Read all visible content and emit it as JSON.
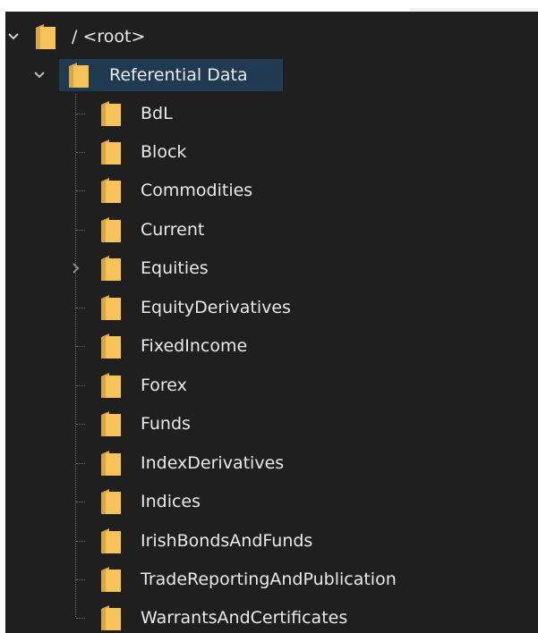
{
  "tree": {
    "root": {
      "label": "/ <root>",
      "expanded": true
    },
    "referential": {
      "label": "Referential Data",
      "expanded": true,
      "selected": true
    },
    "children": [
      {
        "label": "BdL",
        "has_children": false
      },
      {
        "label": "Block",
        "has_children": false
      },
      {
        "label": "Commodities",
        "has_children": false
      },
      {
        "label": "Current",
        "has_children": false
      },
      {
        "label": "Equities",
        "has_children": true
      },
      {
        "label": "EquityDerivatives",
        "has_children": false
      },
      {
        "label": "FixedIncome",
        "has_children": false
      },
      {
        "label": "Forex",
        "has_children": false
      },
      {
        "label": "Funds",
        "has_children": false
      },
      {
        "label": "IndexDerivatives",
        "has_children": false
      },
      {
        "label": "Indices",
        "has_children": false
      },
      {
        "label": "IrishBondsAndFunds",
        "has_children": false
      },
      {
        "label": "TradeReportingAndPublication",
        "has_children": false
      },
      {
        "label": "WarrantsAndCertificates",
        "has_children": false
      }
    ]
  },
  "colors": {
    "background": "#1f1f1f",
    "selection": "#203a52",
    "folder": "#f5c35a",
    "text": "#eaeaea"
  }
}
